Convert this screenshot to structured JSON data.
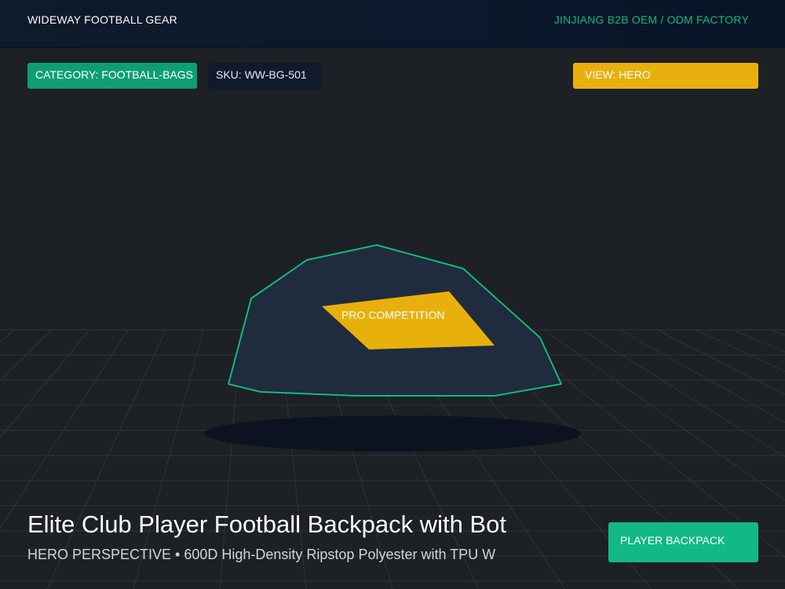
{
  "header": {
    "brand": "WIDEWAY FOOTBALL GEAR",
    "factory": "JINJIANG B2B OEM / ODM FACTORY"
  },
  "chips": {
    "category": "CATEGORY: FOOTBALL-BAGS",
    "sku": "SKU: WW-BG-501",
    "view": "VIEW: HERO"
  },
  "product": {
    "badge": "PRO COMPETITION",
    "title": "Elite Club Player Football Backpack with Bot",
    "subtitle": "HERO PERSPECTIVE • 600D High-Density Ripstop Polyester with TPU W",
    "cta": "PLAYER BACKPACK"
  },
  "colors": {
    "accent_green": "#10b981",
    "accent_yellow": "#e8b00c",
    "bag_fill": "#1f2a3d",
    "background": "#1d2024"
  }
}
